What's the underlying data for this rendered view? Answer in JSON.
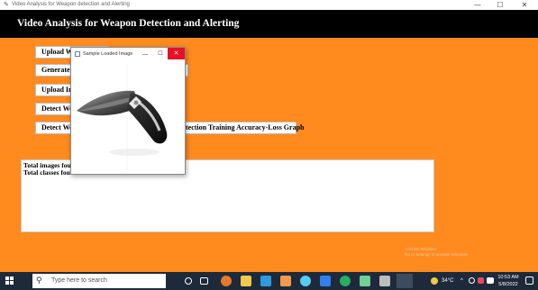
{
  "window": {
    "title": "Video Analysis for Weapon detection and Alerting",
    "min_glyph": "—",
    "max_glyph": "☐",
    "close_glyph": "✕"
  },
  "app": {
    "heading": "Video Analysis for Weapon Detection and Alerting",
    "buttons": [
      "Upload We",
      "Generate &",
      "Upload Im",
      "Detect We",
      "Detect We"
    ],
    "graph_button_suffix": "tection Training Accuracy-Loss Graph",
    "results": [
      "Total images four",
      "Total classes four"
    ],
    "activate_line1": "Activate Windows",
    "activate_line2": "Go to Settings to activate Windows."
  },
  "popup": {
    "title": "Sample Loaded Image",
    "min_glyph": "—",
    "max_glyph": "☐",
    "close_glyph": "✕"
  },
  "taskbar": {
    "search_placeholder": "Type here to search",
    "weather": "34°C",
    "time": "10:53 AM",
    "date": "5/8/2022",
    "tray_chevron": "^"
  },
  "colors": {
    "app_background": "#ff8a1e",
    "header_bar": "#000000",
    "taskbar": "#1e2a3a",
    "popup_close": "#e81123"
  }
}
